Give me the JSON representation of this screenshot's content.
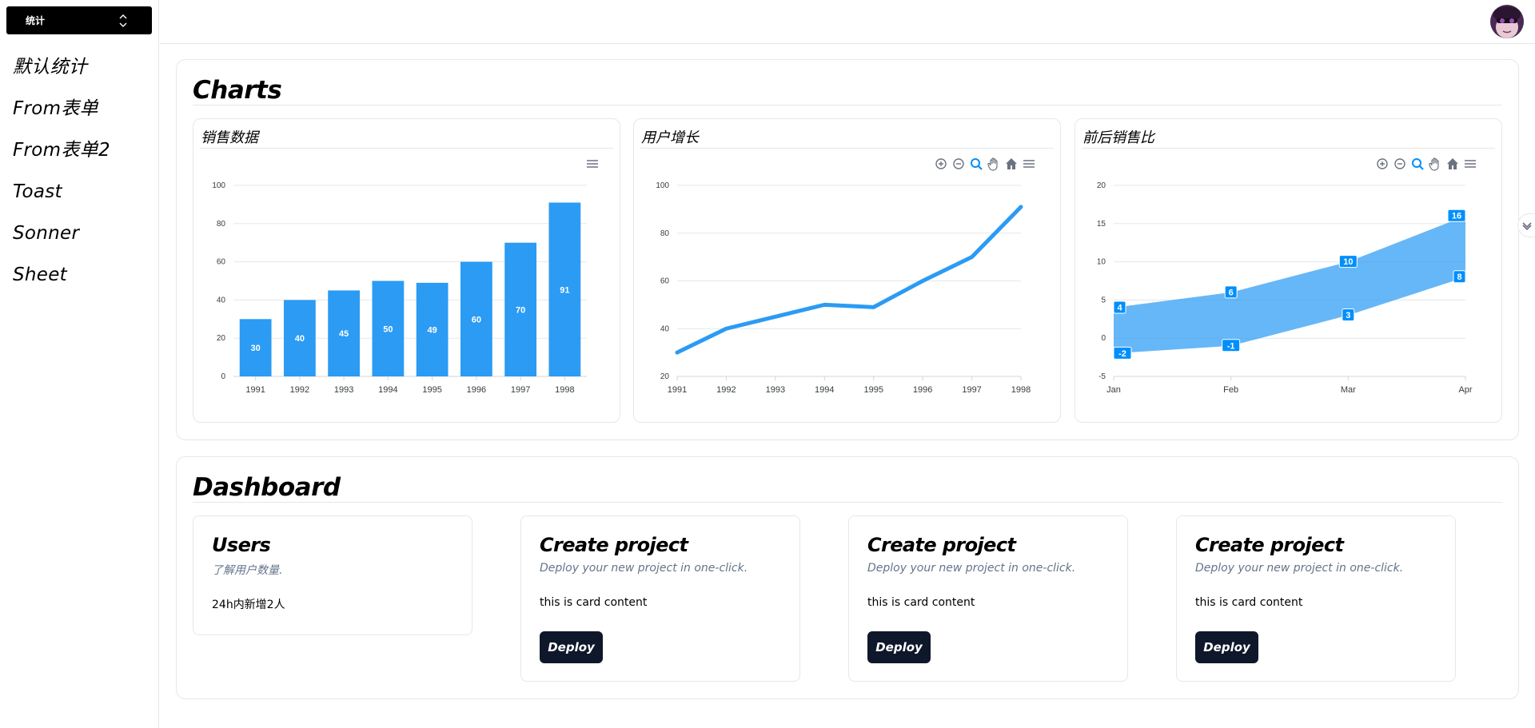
{
  "sidebar": {
    "switcher_label": "统计",
    "items": [
      {
        "label": "默认统计"
      },
      {
        "label": "From表单"
      },
      {
        "label": "From表单2"
      },
      {
        "label": "Toast"
      },
      {
        "label": "Sonner"
      },
      {
        "label": "Sheet"
      }
    ]
  },
  "charts_section": {
    "title": "Charts",
    "cards": [
      {
        "title": "销售数据"
      },
      {
        "title": "用户增长"
      },
      {
        "title": "前后销售比"
      }
    ]
  },
  "chart_data": [
    {
      "type": "bar",
      "title": "销售数据",
      "categories": [
        "1991",
        "1992",
        "1993",
        "1994",
        "1995",
        "1996",
        "1997",
        "1998"
      ],
      "values": [
        30,
        40,
        45,
        50,
        49,
        60,
        70,
        91
      ],
      "data_labels": [
        "30",
        "40",
        "45",
        "50",
        "49",
        "60",
        "70",
        "91"
      ],
      "ylim": [
        0,
        100
      ],
      "yticks": [
        "0",
        "20",
        "40",
        "60",
        "80",
        "100"
      ],
      "color": "#2b9bf4",
      "grid": true
    },
    {
      "type": "line",
      "title": "用户增长",
      "categories": [
        "1991",
        "1992",
        "1993",
        "1994",
        "1995",
        "1996",
        "1997",
        "1998"
      ],
      "values": [
        30,
        40,
        45,
        50,
        49,
        60,
        70,
        91
      ],
      "ylim": [
        20,
        100
      ],
      "yticks": [
        "20",
        "40",
        "60",
        "80",
        "100"
      ],
      "color": "#2b9bf4",
      "grid": true
    },
    {
      "type": "area",
      "title": "前后销售比",
      "categories": [
        "Jan",
        "Feb",
        "Mar",
        "Apr"
      ],
      "upper": [
        4,
        6,
        10,
        16
      ],
      "lower": [
        -2,
        -1,
        3,
        8
      ],
      "upper_labels": [
        "4",
        "6",
        "10",
        "16"
      ],
      "lower_labels": [
        "-2",
        "-1",
        "3",
        "8"
      ],
      "ylim": [
        -5,
        20
      ],
      "yticks": [
        "-5",
        "0",
        "5",
        "10",
        "15",
        "20"
      ],
      "color": "#2b9bf4",
      "grid": true
    }
  ],
  "dashboard": {
    "title": "Dashboard",
    "users_card": {
      "title": "Users",
      "description": "了解用户数量.",
      "content": "24h内新增2人"
    },
    "project_cards": [
      {
        "title": "Create project",
        "description": "Deploy your new project in one-click.",
        "content": "this is card content",
        "button": "Deploy"
      },
      {
        "title": "Create project",
        "description": "Deploy your new project in one-click.",
        "content": "this is card content",
        "button": "Deploy"
      },
      {
        "title": "Create project",
        "description": "Deploy your new project in one-click.",
        "content": "this is card content",
        "button": "Deploy"
      }
    ]
  },
  "icons": {
    "switcher": "chevron-up-down-icon",
    "toolbar": [
      "zoom-in-icon",
      "zoom-out-icon",
      "zoom-select-icon",
      "pan-hand-icon",
      "home-reset-icon",
      "menu-icon"
    ],
    "edge": "chevron-down-icon"
  },
  "colors": {
    "accent": "#2b9bf4",
    "button": "#0f172a",
    "muted_text": "#64748b"
  }
}
